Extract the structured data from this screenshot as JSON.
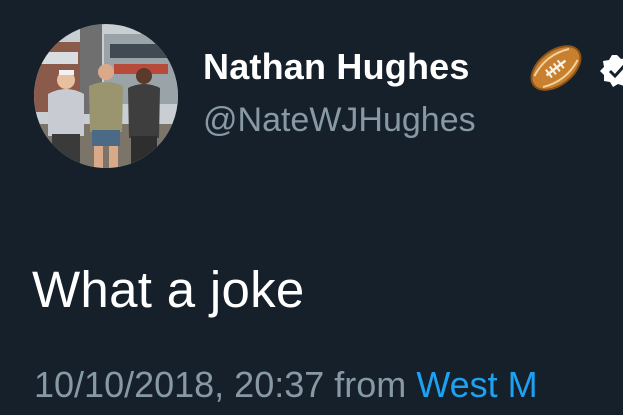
{
  "user": {
    "display_name": "Nathan Hughes",
    "handle": "@NateWJHughes",
    "name_emoji": "rugby-football-icon",
    "verified_badge": "verified-badge-icon"
  },
  "tweet": {
    "text": "What a joke",
    "timestamp": "10/10/2018, 20:37",
    "from_label": "from",
    "source": "West M"
  },
  "colors": {
    "background": "#15202b",
    "primary_text": "#ffffff",
    "secondary_text": "#8899a6",
    "link": "#1da1f2"
  }
}
